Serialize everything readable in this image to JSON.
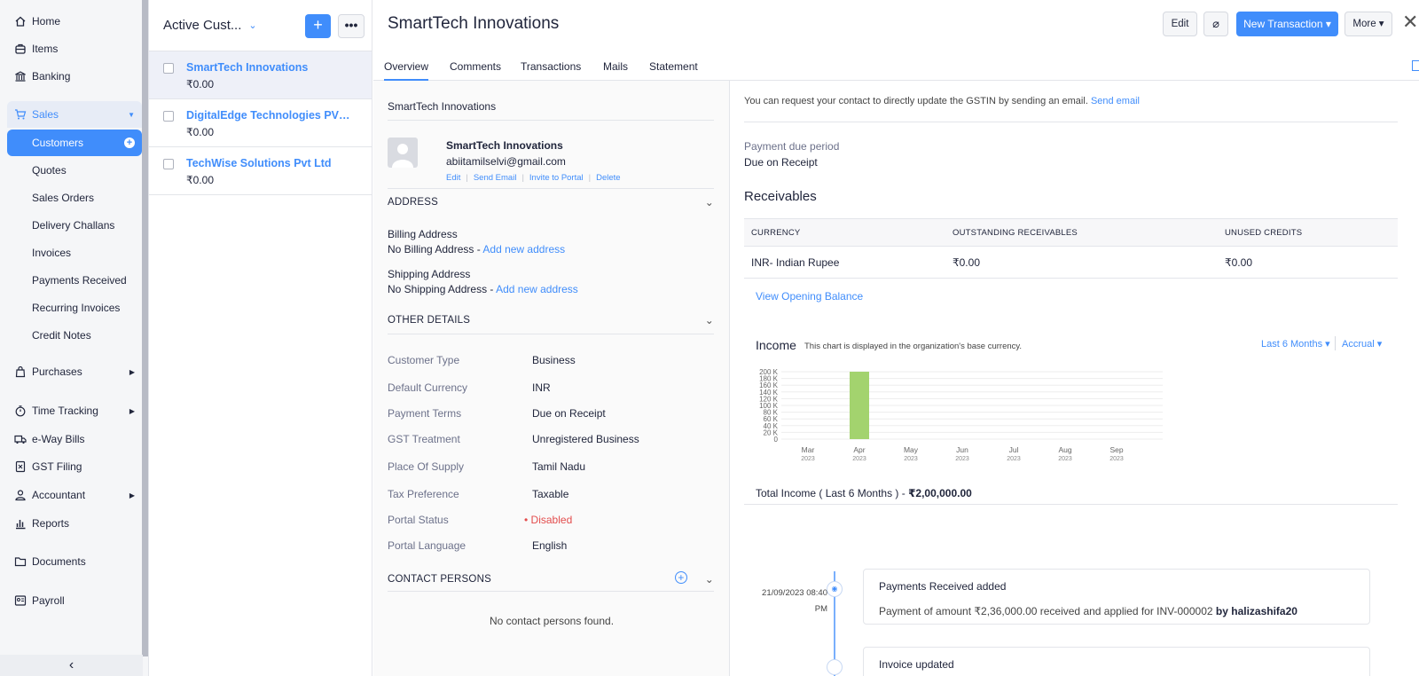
{
  "sidebar": {
    "items": [
      {
        "label": "Home",
        "icon": "home-icon"
      },
      {
        "label": "Items",
        "icon": "items-icon"
      },
      {
        "label": "Banking",
        "icon": "bank-icon"
      },
      {
        "label": "Sales",
        "icon": "cart-icon"
      },
      {
        "label": "Purchases",
        "icon": "bag-icon"
      },
      {
        "label": "Time Tracking",
        "icon": "stopwatch-icon"
      },
      {
        "label": "e-Way Bills",
        "icon": "truck-icon"
      },
      {
        "label": "GST Filing",
        "icon": "gst-icon"
      },
      {
        "label": "Accountant",
        "icon": "user-icon"
      },
      {
        "label": "Reports",
        "icon": "chart-icon"
      },
      {
        "label": "Documents",
        "icon": "folder-icon"
      },
      {
        "label": "Payroll",
        "icon": "payroll-icon"
      }
    ],
    "sales_sub": [
      "Customers",
      "Quotes",
      "Sales Orders",
      "Delivery Challans",
      "Invoices",
      "Payments Received",
      "Recurring Invoices",
      "Credit Notes"
    ],
    "collapse_glyph": "‹"
  },
  "list": {
    "title": "Active Cust...",
    "add_label": "+",
    "more_label": "•••",
    "rows": [
      {
        "name": "SmartTech Innovations",
        "amount": "₹0.00"
      },
      {
        "name": "DigitalEdge Technologies PVT ...",
        "amount": "₹0.00"
      },
      {
        "name": "TechWise Solutions Pvt Ltd",
        "amount": "₹0.00"
      }
    ]
  },
  "detail": {
    "title": "SmartTech Innovations",
    "edit_label": "Edit",
    "new_transaction_label": "New Transaction ▾",
    "more_label": "More ▾",
    "close_glyph": "✕",
    "tabs": [
      "Overview",
      "Comments",
      "Transactions",
      "Mails",
      "Statement"
    ]
  },
  "overview": {
    "company_name": "SmartTech Innovations",
    "contact": {
      "name": "SmartTech Innovations",
      "email": "abiitamilselvi@gmail.com",
      "links": [
        "Edit",
        "Send Email",
        "Invite to Portal",
        "Delete"
      ]
    },
    "address_heading": "ADDRESS",
    "billing_label": "Billing Address",
    "billing_value": "No Billing Address -",
    "shipping_label": "Shipping Address",
    "shipping_value": "No Shipping Address -",
    "add_address_link": "Add new address",
    "other_heading": "OTHER DETAILS",
    "other_details": [
      {
        "key": "Customer Type",
        "value": "Business"
      },
      {
        "key": "Default Currency",
        "value": "INR"
      },
      {
        "key": "Payment Terms",
        "value": "Due on Receipt"
      },
      {
        "key": "GST Treatment",
        "value": "Unregistered Business"
      },
      {
        "key": "Place Of Supply",
        "value": "Tamil Nadu"
      },
      {
        "key": "Tax Preference",
        "value": "Taxable"
      },
      {
        "key": "Portal Status",
        "value": "Disabled"
      },
      {
        "key": "Portal Language",
        "value": "English"
      }
    ],
    "contacts_heading": "CONTACT PERSONS",
    "no_contacts": "No contact persons found."
  },
  "right": {
    "gst_note": "You can request your contact to directly update the GSTIN by sending an email.",
    "send_email_link": "Send email",
    "payment_due_label": "Payment due period",
    "payment_due_value": "Due on Receipt",
    "receivables_title": "Receivables",
    "receivables_headers": [
      "CURRENCY",
      "OUTSTANDING RECEIVABLES",
      "UNUSED CREDITS"
    ],
    "receivables_row": [
      "INR- Indian Rupee",
      "₹0.00",
      "₹0.00"
    ],
    "opening_balance_link": "View Opening Balance",
    "income_title": "Income",
    "income_note": "This chart is displayed in the organization's base currency.",
    "filter_period": "Last 6 Months ▾",
    "filter_basis": "Accrual ▾",
    "total_income_label": "Total Income ( Last 6 Months ) -",
    "total_income_value": "₹2,00,000.00",
    "timeline": {
      "date": "21/09/2023 08:40",
      "time": "PM",
      "title": "Payments Received added",
      "desc": "Payment of amount ₹2,36,000.00 received and applied for INV-000002",
      "by": "by halizashifa20",
      "title2": "Invoice updated"
    }
  },
  "chart_data": {
    "type": "bar",
    "title": "Income",
    "categories": [
      "Mar",
      "Apr",
      "May",
      "Jun",
      "Jul",
      "Aug",
      "Sep"
    ],
    "category_years": [
      "2023",
      "2023",
      "2023",
      "2023",
      "2023",
      "2023",
      "2023"
    ],
    "values": [
      0,
      200000,
      0,
      0,
      0,
      0,
      0
    ],
    "y_ticks": [
      "0",
      "20 K",
      "40 K",
      "60 K",
      "80 K",
      "100 K",
      "120 K",
      "140 K",
      "160 K",
      "180 K",
      "200 K"
    ],
    "ylim": [
      0,
      200000
    ],
    "bar_color": "#a3d36e",
    "grid": true
  },
  "colors": {
    "accent": "#408dfb",
    "bar": "#a3d36e",
    "danger": "#e34d4d"
  }
}
